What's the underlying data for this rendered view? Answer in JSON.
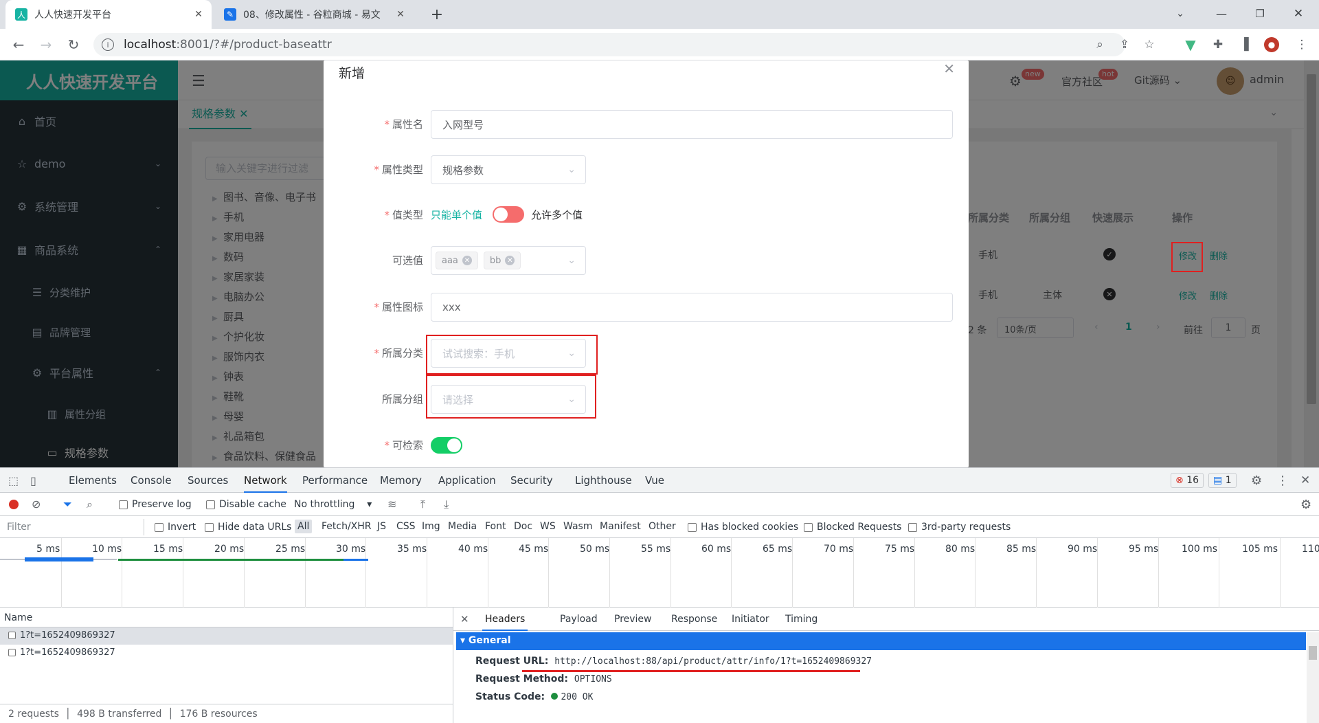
{
  "browser": {
    "tabs": [
      {
        "title": "人人快速开发平台",
        "active": true
      },
      {
        "title": "08、修改属性 - 谷粒商城 - 易文",
        "active": false
      }
    ],
    "url_host": "localhost",
    "url_rest": ":8001/?#/product-baseattr"
  },
  "app": {
    "logo": "人人快速开发平台",
    "sidebar": [
      {
        "label": "首页"
      },
      {
        "label": "demo"
      },
      {
        "label": "系统管理"
      },
      {
        "label": "商品系统"
      },
      {
        "label": "分类维护"
      },
      {
        "label": "品牌管理"
      },
      {
        "label": "平台属性"
      },
      {
        "label": "属性分组"
      },
      {
        "label": "规格参数"
      }
    ],
    "topnav": {
      "badge_new": "new",
      "community": "官方社区",
      "badge_hot": "hot",
      "git": "Git源码",
      "user": "admin"
    },
    "tag": "规格参数",
    "filter_placeholder": "输入关键字进行过滤",
    "tree": [
      "图书、音像、电子书",
      "手机",
      "家用电器",
      "数码",
      "家居家装",
      "电脑办公",
      "厨具",
      "个护化妆",
      "服饰内衣",
      "钟表",
      "鞋靴",
      "母婴",
      "礼品箱包",
      "食品饮料、保健食品"
    ],
    "table": {
      "headers": [
        "所属分类",
        "所属分组",
        "快速展示",
        "操作"
      ],
      "rows": [
        {
          "category": "手机",
          "group": "",
          "quick": "check",
          "edit": "修改",
          "delete": "删除"
        },
        {
          "category": "手机",
          "group": "主体",
          "quick": "cross",
          "edit": "修改",
          "delete": "删除"
        }
      ]
    },
    "pagination": {
      "total": "2 条",
      "page_size": "10条/页",
      "page": "1",
      "goto_label": "前往",
      "goto_value": "1",
      "page_suffix": "页"
    }
  },
  "dialog": {
    "title": "新增",
    "fields": {
      "name_label": "属性名",
      "name_value": "入网型号",
      "type_label": "属性类型",
      "type_value": "规格参数",
      "value_type_label": "值类型",
      "value_type_single": "只能单个值",
      "value_type_multi": "允许多个值",
      "options_label": "可选值",
      "options": [
        "aaa",
        "bb"
      ],
      "icon_label": "属性图标",
      "icon_value": "xxx",
      "category_label": "所属分类",
      "category_placeholder": "试试搜索：手机",
      "group_label": "所属分组",
      "group_placeholder": "请选择",
      "searchable_label": "可检索"
    }
  },
  "devtools": {
    "tabs": [
      "Elements",
      "Console",
      "Sources",
      "Network",
      "Performance",
      "Memory",
      "Application",
      "Security",
      "Lighthouse",
      "Vue"
    ],
    "errors": "16",
    "messages": "1",
    "preserve_log": "Preserve log",
    "disable_cache": "Disable cache",
    "throttling": "No throttling",
    "filter_placeholder": "Filter",
    "invert": "Invert",
    "hide_data_urls": "Hide data URLs",
    "types": [
      "All",
      "Fetch/XHR",
      "JS",
      "CSS",
      "Img",
      "Media",
      "Font",
      "Doc",
      "WS",
      "Wasm",
      "Manifest",
      "Other"
    ],
    "blocked_cookies": "Has blocked cookies",
    "blocked_requests": "Blocked Requests",
    "third_party": "3rd-party requests",
    "ticks": [
      "5 ms",
      "10 ms",
      "15 ms",
      "20 ms",
      "25 ms",
      "30 ms",
      "35 ms",
      "40 ms",
      "45 ms",
      "50 ms",
      "55 ms",
      "60 ms",
      "65 ms",
      "70 ms",
      "75 ms",
      "80 ms",
      "85 ms",
      "90 ms",
      "95 ms",
      "100 ms",
      "105 ms",
      "110"
    ],
    "name_header": "Name",
    "requests": [
      "1?t=1652409869327",
      "1?t=1652409869327"
    ],
    "summary": [
      "2 requests",
      "498 B transferred",
      "176 B resources"
    ],
    "detail_tabs": [
      "Headers",
      "Payload",
      "Preview",
      "Response",
      "Initiator",
      "Timing"
    ],
    "general": "General",
    "request_url_label": "Request URL:",
    "request_url": "http://localhost:88/api/product/attr/info/1?t=1652409869327",
    "request_method_label": "Request Method:",
    "request_method": "OPTIONS",
    "status_label": "Status Code:",
    "status": "200 OK"
  },
  "colors": {
    "accent": "#17b3a3",
    "sidebar": "#263238",
    "danger": "#f56c6c",
    "devtools_blue": "#1a73e8"
  }
}
